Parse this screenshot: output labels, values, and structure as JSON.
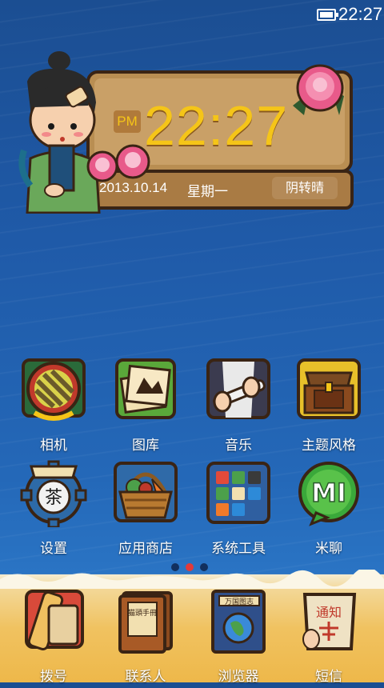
{
  "status_bar": {
    "time": "22:27",
    "battery_icon": "battery-icon"
  },
  "clock_widget": {
    "ampm": "PM",
    "time": "22:27",
    "date": "2013.10.14",
    "weekday": "星期一",
    "weather": "阴转晴"
  },
  "apps": [
    {
      "label": "相机",
      "icon": "camera-icon"
    },
    {
      "label": "图库",
      "icon": "gallery-icon"
    },
    {
      "label": "音乐",
      "icon": "music-flute-icon"
    },
    {
      "label": "主题风格",
      "icon": "treasure-chest-icon"
    },
    {
      "label": "设置",
      "icon": "tea-gear-icon"
    },
    {
      "label": "应用商店",
      "icon": "vegetable-basket-icon"
    },
    {
      "label": "系统工具",
      "icon": "folder-icon"
    },
    {
      "label": "米聊",
      "icon": "mi-chat-icon"
    }
  ],
  "page_indicator": {
    "pages": 3,
    "active": 2
  },
  "dock": [
    {
      "label": "拨号",
      "icon": "scroll-phone-icon"
    },
    {
      "label": "联系人",
      "icon": "book-contacts-icon",
      "cover_text": "猫頭手冊"
    },
    {
      "label": "浏览器",
      "icon": "book-globe-icon",
      "cover_text": "万国图志"
    },
    {
      "label": "短信",
      "icon": "notice-scroll-icon",
      "cover_text": "通知"
    }
  ],
  "colors": {
    "sea": "#1f5aa8",
    "sand": "#efc86a",
    "clock_yellow": "#f5c518",
    "board": "#b98e52"
  }
}
